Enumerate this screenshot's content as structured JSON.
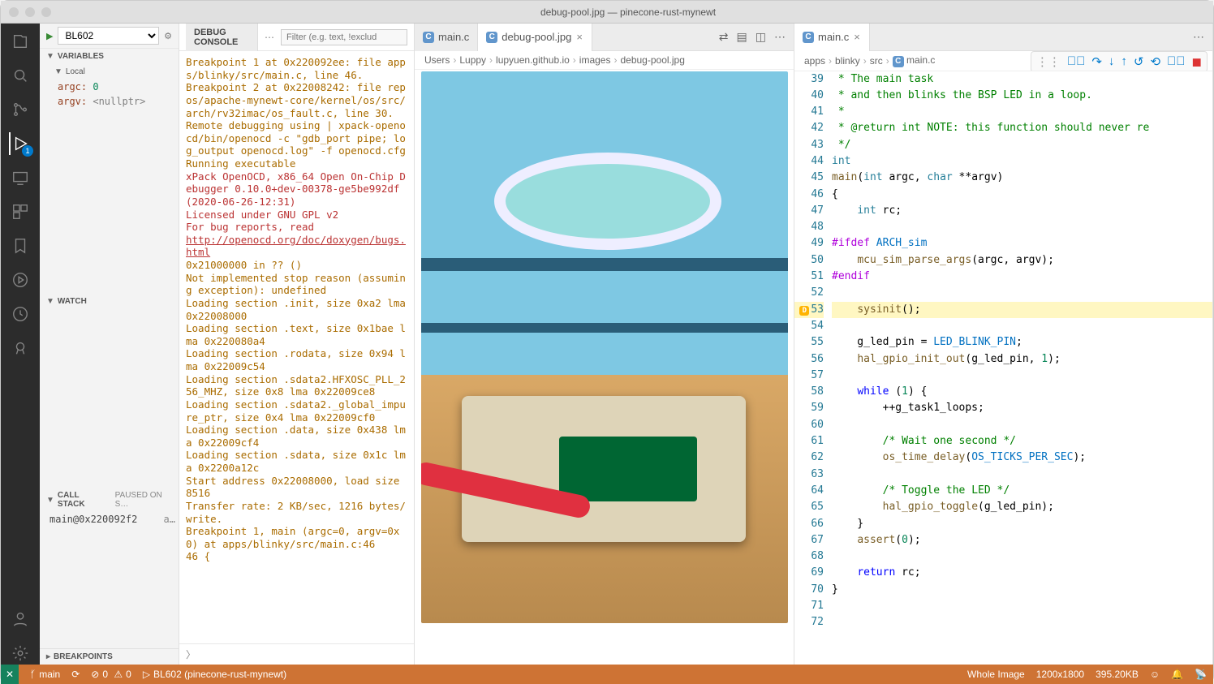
{
  "window": {
    "title": "debug-pool.jpg — pinecone-rust-mynewt"
  },
  "activity": {
    "debug_badge": "1"
  },
  "debug_sidebar": {
    "config": "BL602",
    "sections": {
      "variables": "VARIABLES",
      "local": "Local",
      "watch": "WATCH",
      "callstack": "CALL STACK",
      "paused": "PAUSED ON S…",
      "breakpoints": "BREAKPOINTS"
    },
    "vars": {
      "argc_name": "argc:",
      "argc_val": "0",
      "argv_name": "argv:",
      "argv_val": "<nullptr>"
    },
    "callstack": {
      "frame": "main@0x220092f2",
      "extra": "a…"
    }
  },
  "console": {
    "title": "DEBUG CONSOLE",
    "filter_placeholder": "Filter (e.g. text, !exclud",
    "lines": [
      {
        "cls": "c-y",
        "t": "Breakpoint 1 at 0x220092ee: file apps/blinky/src/main.c, line 46."
      },
      {
        "cls": "c-y",
        "t": "Breakpoint 2 at 0x22008242: file repos/apache-mynewt-core/kernel/os/src/arch/rv32imac/os_fault.c, line 30."
      },
      {
        "cls": "c-y",
        "t": "Remote debugging using | xpack-openocd/bin/openocd -c \"gdb_port pipe; log_output openocd.log\" -f openocd.cfg"
      },
      {
        "cls": "c-y",
        "t": "Running executable"
      },
      {
        "cls": "c-r",
        "t": "xPack OpenOCD, x86_64 Open On-Chip Debugger 0.10.0+dev-00378-ge5be992df (2020-06-26-12:31)"
      },
      {
        "cls": "c-r",
        "t": "Licensed under GNU GPL v2"
      },
      {
        "cls": "c-r",
        "t": "For bug reports, read"
      },
      {
        "cls": "c-link",
        "t": "        http://openocd.org/doc/doxygen/bugs.html"
      },
      {
        "cls": "c-y",
        "t": "0x21000000 in ?? ()"
      },
      {
        "cls": "c-y",
        "t": "Not implemented stop reason (assuming exception): undefined"
      },
      {
        "cls": "c-y",
        "t": "Loading section .init, size 0xa2 lma 0x22008000"
      },
      {
        "cls": "c-y",
        "t": "Loading section .text, size 0x1bae lma 0x220080a4"
      },
      {
        "cls": "c-y",
        "t": "Loading section .rodata, size 0x94 lma 0x22009c54"
      },
      {
        "cls": "c-y",
        "t": "Loading section .sdata2.HFXOSC_PLL_256_MHZ, size 0x8 lma 0x22009ce8"
      },
      {
        "cls": "c-y",
        "t": "Loading section .sdata2._global_impure_ptr, size 0x4 lma 0x22009cf0"
      },
      {
        "cls": "c-y",
        "t": "Loading section .data, size 0x438 lma 0x22009cf4"
      },
      {
        "cls": "c-y",
        "t": "Loading section .sdata, size 0x1c lma 0x2200a12c"
      },
      {
        "cls": "c-y",
        "t": "Start address 0x22008000, load size 8516"
      },
      {
        "cls": "c-y",
        "t": "Transfer rate: 2 KB/sec, 1216 bytes/write."
      },
      {
        "cls": "",
        "t": " "
      },
      {
        "cls": "c-y",
        "t": "Breakpoint 1, main (argc=0, argv=0x0) at apps/blinky/src/main.c:46"
      },
      {
        "cls": "c-y",
        "t": "46        {"
      }
    ]
  },
  "group_image": {
    "tabs": [
      {
        "label": "main.c",
        "active": false
      },
      {
        "label": "debug-pool.jpg",
        "active": true
      }
    ],
    "crumbs": [
      "Users",
      "Luppy",
      "lupyuen.github.io",
      "images",
      "debug-pool.jpg"
    ]
  },
  "group_code": {
    "tabs": [
      {
        "label": "main.c",
        "active": true
      }
    ],
    "crumbs": [
      "apps",
      "blinky",
      "src",
      "main.c"
    ],
    "highlight_line": 53,
    "lines": [
      {
        "n": 39,
        "html": "<span class='cm'> * The main task</span>"
      },
      {
        "n": 40,
        "html": "<span class='cm'> * and then blinks the BSP LED in a loop.</span>"
      },
      {
        "n": 41,
        "html": "<span class='cm'> *</span>"
      },
      {
        "n": 42,
        "html": "<span class='cm'> * @return int NOTE: this function should never re</span>"
      },
      {
        "n": 43,
        "html": "<span class='cm'> */</span>"
      },
      {
        "n": 44,
        "html": "<span class='ty'>int</span>"
      },
      {
        "n": 45,
        "html": "<span class='fn'>main</span>(<span class='ty'>int</span> argc, <span class='ty'>char</span> **argv)"
      },
      {
        "n": 46,
        "html": "{"
      },
      {
        "n": 47,
        "html": "    <span class='ty'>int</span> rc;"
      },
      {
        "n": 48,
        "html": ""
      },
      {
        "n": 49,
        "html": "<span class='pp'>#ifdef</span> <span class='mc'>ARCH_sim</span>"
      },
      {
        "n": 50,
        "html": "    <span class='fn'>mcu_sim_parse_args</span>(argc, argv);"
      },
      {
        "n": 51,
        "html": "<span class='pp'>#endif</span>"
      },
      {
        "n": 52,
        "html": ""
      },
      {
        "n": 53,
        "html": "    <span class='fn'>sysinit</span>();"
      },
      {
        "n": 54,
        "html": ""
      },
      {
        "n": 55,
        "html": "    g_led_pin = <span class='mc'>LED_BLINK_PIN</span>;"
      },
      {
        "n": 56,
        "html": "    <span class='fn'>hal_gpio_init_out</span>(g_led_pin, <span class='nm'>1</span>);"
      },
      {
        "n": 57,
        "html": ""
      },
      {
        "n": 58,
        "html": "    <span class='kw'>while</span> (<span class='nm'>1</span>) {"
      },
      {
        "n": 59,
        "html": "        ++g_task1_loops;"
      },
      {
        "n": 60,
        "html": ""
      },
      {
        "n": 61,
        "html": "        <span class='cm'>/* Wait one second */</span>"
      },
      {
        "n": 62,
        "html": "        <span class='fn'>os_time_delay</span>(<span class='mc'>OS_TICKS_PER_SEC</span>);"
      },
      {
        "n": 63,
        "html": ""
      },
      {
        "n": 64,
        "html": "        <span class='cm'>/* Toggle the LED */</span>"
      },
      {
        "n": 65,
        "html": "        <span class='fn'>hal_gpio_toggle</span>(g_led_pin);"
      },
      {
        "n": 66,
        "html": "    }"
      },
      {
        "n": 67,
        "html": "    <span class='fn'>assert</span>(<span class='nm'>0</span>);"
      },
      {
        "n": 68,
        "html": ""
      },
      {
        "n": 69,
        "html": "    <span class='kw'>return</span> rc;"
      },
      {
        "n": 70,
        "html": "}"
      },
      {
        "n": 71,
        "html": ""
      },
      {
        "n": 72,
        "html": ""
      }
    ]
  },
  "status": {
    "branch": "main",
    "errors": "0",
    "warnings": "0",
    "target": "BL602 (pinecone-rust-mynewt)",
    "image_label": "Whole Image",
    "image_dim": "1200x1800",
    "image_size": "395.20KB"
  }
}
